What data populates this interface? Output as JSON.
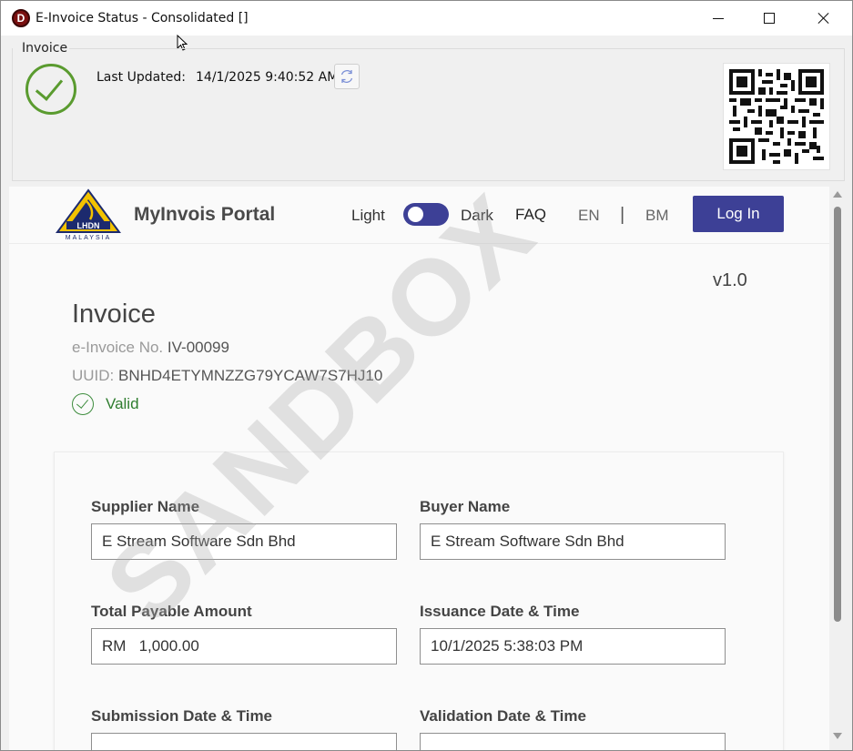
{
  "window": {
    "title": "E-Invoice Status - Consolidated []",
    "app_icon_letter": "D"
  },
  "invoice_panel": {
    "group_label": "Invoice",
    "last_updated_label": "Last Updated:",
    "last_updated_value": "14/1/2025 9:40:52 AM",
    "status_icon": "check-circle-icon",
    "refresh_icon": "refresh-icon",
    "qr_icon": "qr-code-icon"
  },
  "portal": {
    "logo_text": "LHDN",
    "logo_subtext": "MALAYSIA",
    "title": "MyInvois Portal",
    "light_label": "Light",
    "dark_label": "Dark",
    "faq_label": "FAQ",
    "lang_en": "EN",
    "lang_sep": "|",
    "lang_bm": "BM",
    "login_label": "Log In",
    "version": "v1.0",
    "watermark": "SANDBOX",
    "accent_color": "#3d4096"
  },
  "invoice": {
    "heading": "Invoice",
    "einvoice_label": "e-Invoice No.",
    "einvoice_no": "IV-00099",
    "uuid_label": "UUID:",
    "uuid": "BNHD4ETYMNZZG79YCAW7S7HJ10",
    "status": "Valid",
    "status_color": "#2f7d2f"
  },
  "fields": {
    "supplier_name_label": "Supplier Name",
    "supplier_name": "E Stream Software Sdn Bhd",
    "buyer_name_label": "Buyer Name",
    "buyer_name": "E Stream Software Sdn Bhd",
    "total_payable_label": "Total Payable Amount",
    "total_payable": "RM   1,000.00",
    "issuance_label": "Issuance Date & Time",
    "issuance": "10/1/2025 5:38:03 PM",
    "submission_label": "Submission Date & Time",
    "validation_label": "Validation Date & Time"
  }
}
